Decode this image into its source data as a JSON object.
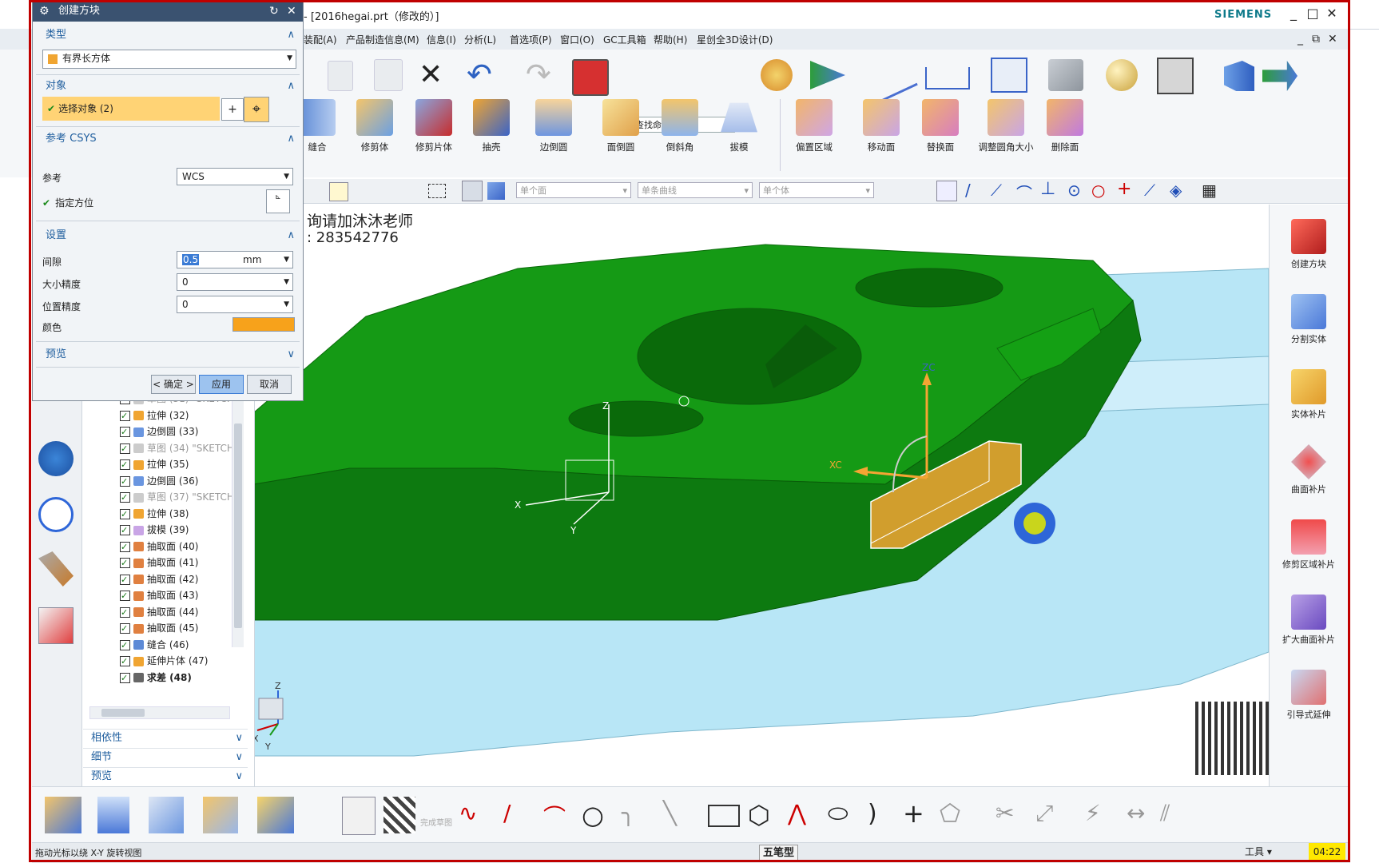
{
  "window": {
    "title": "- [2016hegai.prt（修改的）]",
    "brand": "SIEMENS",
    "minimize_glyph": "_",
    "restore_glyph": "□",
    "close_glyph": "✕"
  },
  "menu": [
    "装配(A)",
    "产品制造信息(M)",
    "信息(I)",
    "分析(L)",
    "首选项(P)",
    "窗口(O)",
    "GC工具箱",
    "帮助(H)",
    "星创全3D设计(D)"
  ],
  "menu_right": {
    "min": "_",
    "restore": "⧉",
    "close": "✕"
  },
  "ribbon": {
    "search_placeholder": "查找命令",
    "tools": [
      "缝合",
      "修剪体",
      "修剪片体",
      "抽壳",
      "边倒圆",
      "面倒圆",
      "倒斜角",
      "拔模",
      "偏置区域",
      "移动面",
      "替换面",
      "调整圆角大小",
      "删除面"
    ]
  },
  "selection_bar": {
    "filter1": "单个面",
    "filter2": "单条曲线",
    "filter3": "单个体"
  },
  "viewport": {
    "watermark_line1": "询请加沐沐老师",
    "watermark_line2": ": 283542776",
    "csys_labels": {
      "z": "Z",
      "x": "X",
      "y": "Y",
      "xc": "XC",
      "zc": "ZC"
    },
    "triad": {
      "z": "Z",
      "x": "X",
      "y": "Y"
    }
  },
  "right_bar": {
    "tools": [
      "创建方块",
      "分割实体",
      "实体补片",
      "曲面补片",
      "修剪区域补片",
      "扩大曲面补片",
      "引导式延伸"
    ]
  },
  "dialog": {
    "title": "创建方块",
    "sections": {
      "type": "类型",
      "object": "对象",
      "csys": "参考 CSYS",
      "settings": "设置",
      "preview": "预览"
    },
    "type_value": "有界长方体",
    "select_object": "选择对象 (2)",
    "reference_label": "参考",
    "reference_value": "WCS",
    "orientation_label": "指定方位",
    "gap_label": "间隙",
    "gap_value": "0.5",
    "gap_unit": "mm",
    "size_precision_label": "大小精度",
    "size_precision_value": "0",
    "pos_precision_label": "位置精度",
    "pos_precision_value": "0",
    "color_label": "颜色",
    "color_value": "#f7a21b",
    "ok": "< 确定 >",
    "apply": "应用",
    "cancel": "取消"
  },
  "tree": [
    {
      "label": "草图 (31) \"SKETCH",
      "dim": true,
      "icon": "sketch-icon"
    },
    {
      "label": "拉伸 (32)",
      "dim": false,
      "icon": "extrude-icon"
    },
    {
      "label": "边倒圆 (33)",
      "dim": false,
      "icon": "edge-blend-icon"
    },
    {
      "label": "草图 (34) \"SKETCH",
      "dim": true,
      "icon": "sketch-icon"
    },
    {
      "label": "拉伸 (35)",
      "dim": false,
      "icon": "extrude-icon"
    },
    {
      "label": "边倒圆 (36)",
      "dim": false,
      "icon": "edge-blend-icon"
    },
    {
      "label": "草图 (37) \"SKETCH",
      "dim": true,
      "icon": "sketch-icon"
    },
    {
      "label": "拉伸 (38)",
      "dim": false,
      "icon": "extrude-icon"
    },
    {
      "label": "拔模 (39)",
      "dim": false,
      "icon": "draft-icon"
    },
    {
      "label": "抽取面 (40)",
      "dim": false,
      "icon": "extract-face-icon"
    },
    {
      "label": "抽取面 (41)",
      "dim": false,
      "icon": "extract-face-icon"
    },
    {
      "label": "抽取面 (42)",
      "dim": false,
      "icon": "extract-face-icon"
    },
    {
      "label": "抽取面 (43)",
      "dim": false,
      "icon": "extract-face-icon"
    },
    {
      "label": "抽取面 (44)",
      "dim": false,
      "icon": "extract-face-icon"
    },
    {
      "label": "抽取面 (45)",
      "dim": false,
      "icon": "extract-face-icon"
    },
    {
      "label": "缝合 (46)",
      "dim": false,
      "icon": "sew-icon"
    },
    {
      "label": "延伸片体 (47)",
      "dim": false,
      "icon": "extend-sheet-icon"
    },
    {
      "label": "求差 (48)",
      "dim": false,
      "bold": true,
      "icon": "subtract-icon"
    }
  ],
  "nav_sections": [
    "相依性",
    "细节",
    "预览"
  ],
  "bottom_toolbar": {
    "finish_sketch": "完成草图"
  },
  "status": {
    "message": "拖动光标以绕 X-Y 旋转视图",
    "ime": "五笔型",
    "tools_menu": "工具",
    "time": "04:22"
  }
}
